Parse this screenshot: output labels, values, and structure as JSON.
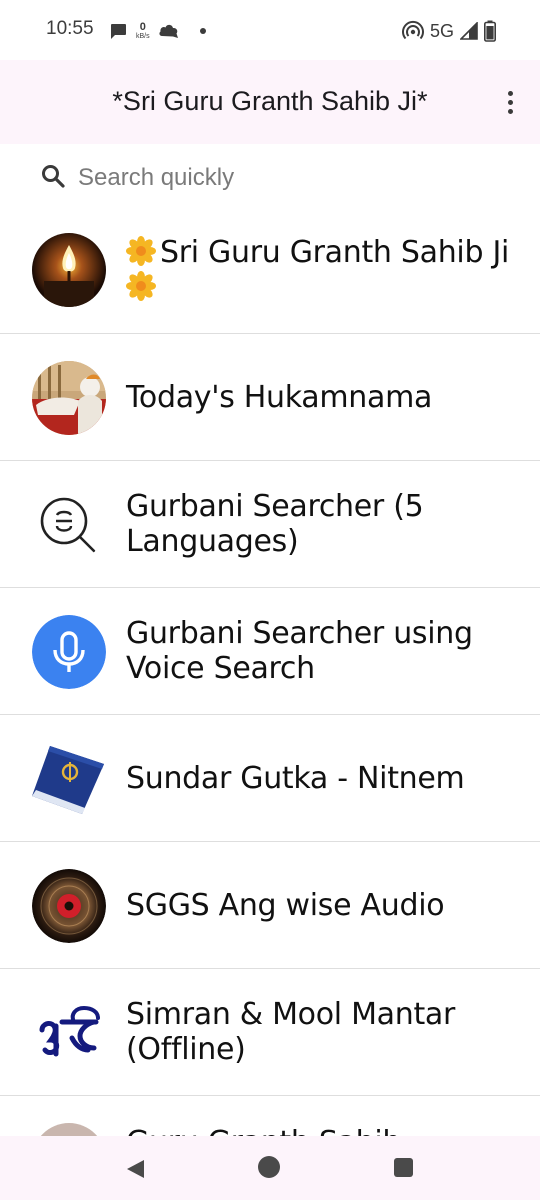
{
  "status_bar": {
    "time": "10:55",
    "net_speed_value": "0",
    "net_speed_unit": "kB/s",
    "network_type": "5G",
    "icons": [
      "chat-icon",
      "cloud-icon",
      "hotspot-icon",
      "signal-icon",
      "battery-icon"
    ]
  },
  "app_bar": {
    "title": "*Sri Guru Granth Sahib Ji*",
    "menu_icon": "more-vert-icon"
  },
  "search": {
    "placeholder": "Search quickly",
    "value": "",
    "icon": "search-icon"
  },
  "items": [
    {
      "label": "Sri Guru Granth Sahib Ji",
      "icon": "candle-flame-icon",
      "decoration": "flower-icon"
    },
    {
      "label": "Today's Hukamnama",
      "icon": "hukamnama-photo-icon"
    },
    {
      "label": "Gurbani Searcher (5 Languages)",
      "icon": "gurmukhi-search-icon"
    },
    {
      "label": "Gurbani Searcher using Voice Search",
      "icon": "microphone-icon"
    },
    {
      "label": "Sundar Gutka - Nitnem",
      "icon": "gutka-book-icon"
    },
    {
      "label": "SGGS Ang wise Audio",
      "icon": "vinyl-record-icon"
    },
    {
      "label": "Simran & Mool Mantar (Offline)",
      "icon": "ik-onkar-icon"
    },
    {
      "label": "Guru Granth Sahib",
      "icon": "granth-photo-icon"
    }
  ],
  "colors": {
    "app_bar_background": "#fdf4fb",
    "nav_bar_background": "#fdf4fb",
    "voice_icon_blue": "#3b82f0",
    "ik_onkar_navy": "#141a7e",
    "divider": "#dedede"
  },
  "nav_bar": {
    "icons": [
      "back-icon",
      "home-icon",
      "recents-icon"
    ]
  }
}
